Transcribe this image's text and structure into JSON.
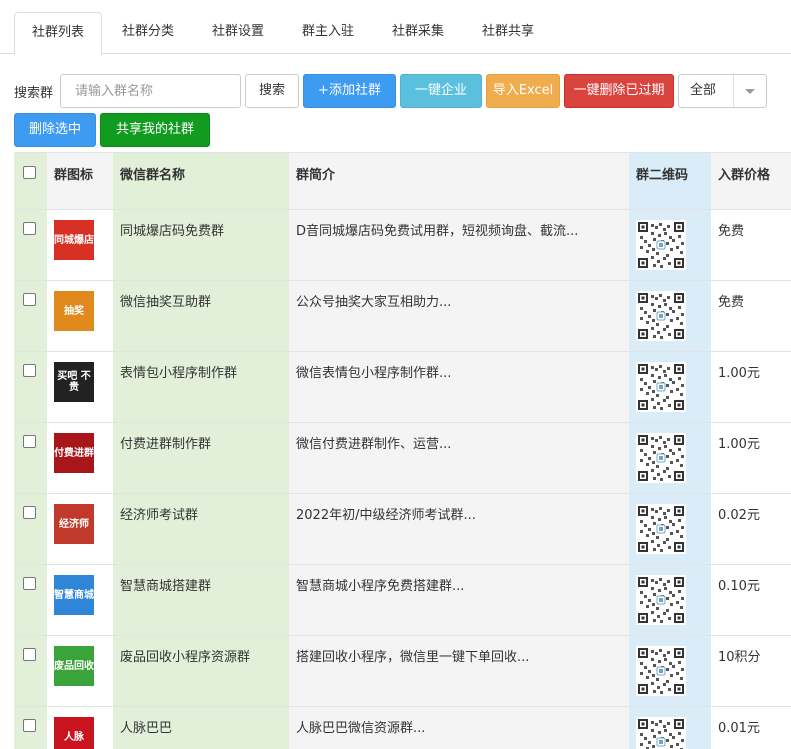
{
  "tabs": [
    "社群列表",
    "社群分类",
    "社群设置",
    "群主入驻",
    "社群采集",
    "社群共享"
  ],
  "toolbar": {
    "search_label": "搜索群",
    "search_placeholder": "请输入群名称",
    "search_value": "",
    "search_button": "搜索",
    "add_button": "+添加社群",
    "company_button": "一键企业",
    "import_button": "导入Excel",
    "delete_expired_button": "一键删除已过期",
    "filter_value": "全部",
    "delete_selected_button": "删除选中",
    "share_button": "共享我的社群"
  },
  "table": {
    "headers": {
      "icon": "群图标",
      "name": "微信群名称",
      "desc": "群简介",
      "qr": "群二维码",
      "price": "入群价格"
    },
    "rows": [
      {
        "name": "同城爆店码免费群",
        "desc": "D音同城爆店码免费试用群，短视频询盘、截流...",
        "price": "免费",
        "icon_text": "同城爆店",
        "icon_color": "#d93025"
      },
      {
        "name": "微信抽奖互助群",
        "desc": "公众号抽奖大家互相助力...",
        "price": "免费",
        "icon_text": "抽奖",
        "icon_color": "#e08a1e"
      },
      {
        "name": "表情包小程序制作群",
        "desc": "微信表情包小程序制作群...",
        "price": "1.00元",
        "icon_text": "买吧 不贵",
        "icon_color": "#222222"
      },
      {
        "name": "付费进群制作群",
        "desc": "微信付费进群制作、运营...",
        "price": "1.00元",
        "icon_text": "付费进群",
        "icon_color": "#a8161a"
      },
      {
        "name": "经济师考试群",
        "desc": "2022年初/中级经济师考试群...",
        "price": "0.02元",
        "icon_text": "经济师",
        "icon_color": "#c0392b"
      },
      {
        "name": "智慧商城搭建群",
        "desc": "智慧商城小程序免费搭建群...",
        "price": "0.10元",
        "icon_text": "智慧商城",
        "icon_color": "#2f86d6"
      },
      {
        "name": "废品回收小程序资源群",
        "desc": "搭建回收小程序，微信里一键下单回收...",
        "price": "10积分",
        "icon_text": "废品回收",
        "icon_color": "#3aa33a"
      },
      {
        "name": "人脉巴巴",
        "desc": "人脉巴巴微信资源群...",
        "price": "0.01元",
        "icon_text": "人脉",
        "icon_color": "#c8141e"
      }
    ]
  }
}
